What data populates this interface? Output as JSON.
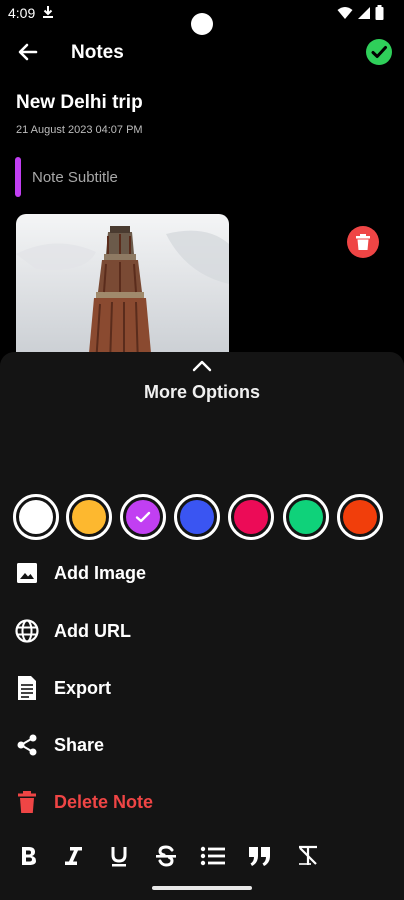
{
  "status_bar": {
    "time": "4:09"
  },
  "app_bar": {
    "title": "Notes"
  },
  "note": {
    "title": "New Delhi trip",
    "datetime": "21 August 2023 04:07 PM",
    "subtitle_placeholder": "Note Subtitle",
    "subtitle_accent_color": "#c13ff2",
    "image_icon": "photo-qutub-minar"
  },
  "more_options": {
    "title": "More Options",
    "colors": [
      {
        "name": "white",
        "hex": "#ffffff",
        "selected": false
      },
      {
        "name": "yellow",
        "hex": "#fdb82f",
        "selected": false
      },
      {
        "name": "purple",
        "hex": "#c13ff2",
        "selected": true
      },
      {
        "name": "blue",
        "hex": "#3a55f2",
        "selected": false
      },
      {
        "name": "pink",
        "hex": "#ec0b57",
        "selected": false
      },
      {
        "name": "green",
        "hex": "#0fd27a",
        "selected": false
      },
      {
        "name": "orange",
        "hex": "#f13e0b",
        "selected": false
      }
    ],
    "items": [
      {
        "label": "Add Image",
        "icon": "image-icon"
      },
      {
        "label": "Add URL",
        "icon": "globe-icon"
      },
      {
        "label": "Export",
        "icon": "export-icon"
      },
      {
        "label": "Share",
        "icon": "share-icon"
      },
      {
        "label": "Delete Note",
        "icon": "trash-icon",
        "color": "#ef4545"
      }
    ]
  },
  "formatting_toolbar": [
    "bold-icon",
    "italic-icon",
    "underline-icon",
    "strikethrough-icon",
    "bulleted-list-icon",
    "quote-icon",
    "clear-format-icon"
  ]
}
